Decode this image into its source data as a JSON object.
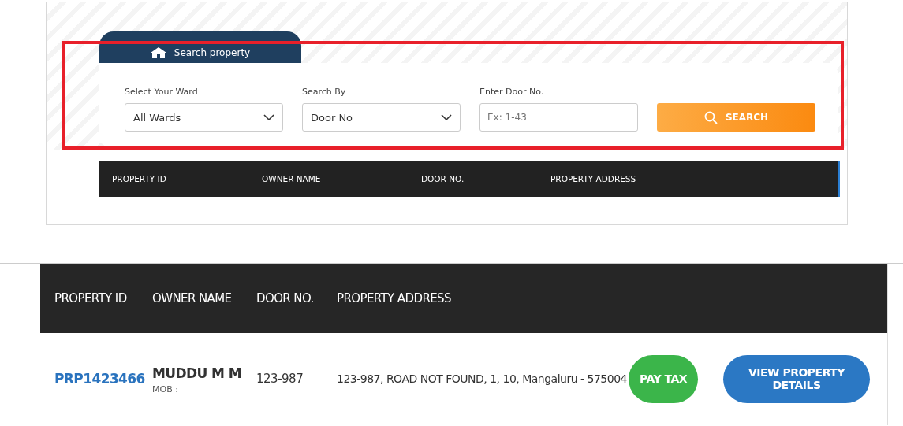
{
  "search_panel": {
    "tab": {
      "label": "Search property"
    },
    "fields": [
      {
        "kind": "select",
        "label": "Select Your Ward",
        "value": "All Wards"
      },
      {
        "kind": "select",
        "label": "Search By",
        "value": "Door No"
      },
      {
        "kind": "input",
        "label": "Enter Door No.",
        "placeholder": "Ex: 1-43"
      }
    ],
    "search_button": "SEARCH",
    "table_columns": [
      "PROPERTY ID",
      "OWNER NAME",
      "DOOR NO.",
      "PROPERTY ADDRESS"
    ]
  },
  "results_table": {
    "columns": [
      "PROPERTY ID",
      "OWNER NAME",
      "DOOR NO.",
      "PROPERTY ADDRESS"
    ],
    "rows": [
      {
        "property_id": "PRP1423466",
        "owner_name": "MUDDU M M",
        "mobile_label": "MOB :",
        "door_no": "123-987",
        "address": "123-987, ROAD NOT FOUND, 1, 10, Mangaluru - 575004",
        "actions": [
          {
            "kind": "pay",
            "label": "PAY TAX"
          },
          {
            "kind": "view",
            "label": "VIEW PROPERTY DETAILS"
          }
        ]
      }
    ]
  }
}
